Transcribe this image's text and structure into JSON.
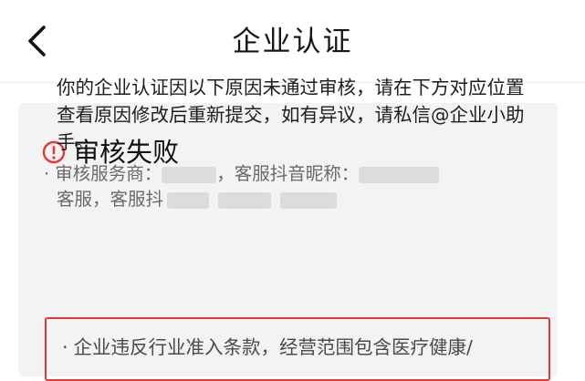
{
  "header": {
    "title": "企业认证"
  },
  "status": {
    "title": "审核失败",
    "icon": "alert-circle-icon",
    "icon_color": "#e53935"
  },
  "description": "你的企业认证因以下原因未通过审核，请在下方对应位置查看原因修改后重新提交，如有异议，请私信@企业小助手。",
  "reviewer": {
    "prefix": "审核服务商：",
    "nickname_label": "，客服抖音昵称：",
    "service_label": "客服，客服抖"
  },
  "reason": {
    "text": "企业违反行业准入条款，经营范围包含医疗健康/",
    "border_color": "#e53935"
  }
}
